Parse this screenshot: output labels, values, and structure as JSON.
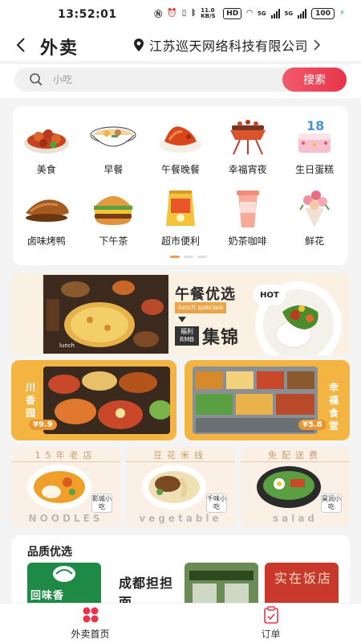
{
  "status": {
    "time": "13:52:01",
    "net_speed": "11.0 KB/S",
    "hd": "HD",
    "sig1": "5G",
    "sig2": "5G",
    "battery": "100"
  },
  "header": {
    "title": "外卖",
    "location": "江苏巡天网络科技有限公司"
  },
  "search": {
    "placeholder": "小吃",
    "button": "搜索"
  },
  "categories": [
    {
      "label": "美食",
      "icon": "food-platter-icon"
    },
    {
      "label": "早餐",
      "icon": "noodle-bowl-icon"
    },
    {
      "label": "午餐晚餐",
      "icon": "roast-duck-icon"
    },
    {
      "label": "幸福宵夜",
      "icon": "bbq-grill-icon"
    },
    {
      "label": "生日蛋糕",
      "icon": "birthday-cake-icon"
    },
    {
      "label": "卤味烤鸭",
      "icon": "braised-meat-icon"
    },
    {
      "label": "下午茶",
      "icon": "burger-icon"
    },
    {
      "label": "超市便利",
      "icon": "snack-bag-icon"
    },
    {
      "label": "奶茶咖啡",
      "icon": "milk-tea-icon"
    },
    {
      "label": "鲜花",
      "icon": "flower-bouquet-icon"
    }
  ],
  "banner": {
    "title": "午餐优选",
    "subtitle": "lunch    specials",
    "tag_top": "福利",
    "tag_bottom": "RMB",
    "headline": "集锦",
    "hot": "HOT",
    "photo_caption": "lunch"
  },
  "promos": [
    {
      "name": "川香园",
      "price": "¥9.9"
    },
    {
      "name": "幸福食堂",
      "price": "¥5.8"
    }
  ],
  "noodles": [
    {
      "top": "15年老店",
      "bottom": "NOODLES",
      "tag": "影城小吃"
    },
    {
      "top": "豆花米线",
      "bottom": "vegetable",
      "tag": "千味小吃"
    },
    {
      "top": "免配送费",
      "bottom": "salad",
      "tag": "昊润小吃"
    }
  ],
  "quality": {
    "title": "品质优选",
    "items": [
      {
        "name": "回味香"
      },
      {
        "name": "成都担担面"
      },
      {
        "name": ""
      },
      {
        "name": "实在饭店"
      }
    ]
  },
  "nav": [
    {
      "label": "外卖首页",
      "icon": "home-grid-icon"
    },
    {
      "label": "订单",
      "icon": "order-clipboard-icon"
    }
  ],
  "colors": {
    "accent": "#e8354b",
    "promo": "#f4b441",
    "dot_active": "#f39a54"
  }
}
